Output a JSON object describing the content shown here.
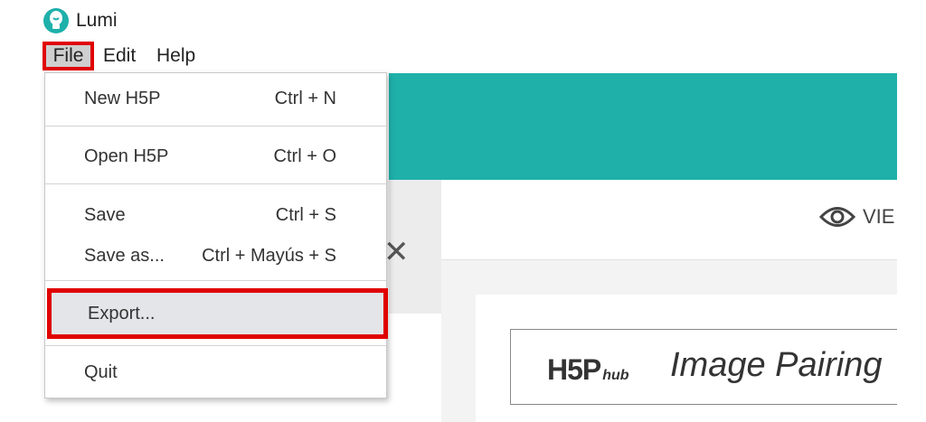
{
  "app": {
    "title": "Lumi"
  },
  "menubar": {
    "file": "File",
    "edit": "Edit",
    "help": "Help"
  },
  "file_menu": {
    "new": {
      "label": "New H5P",
      "shortcut": "Ctrl + N"
    },
    "open": {
      "label": "Open H5P",
      "shortcut": "Ctrl + O"
    },
    "save": {
      "label": "Save",
      "shortcut": "Ctrl + S"
    },
    "save_as": {
      "label": "Save as...",
      "shortcut": "Ctrl + Mayús + S"
    },
    "export": {
      "label": "Export..."
    },
    "quit": {
      "label": "Quit"
    }
  },
  "editor": {
    "view_label": "VIE",
    "hub_logo_main": "H5P",
    "hub_logo_sub": "hub",
    "content_title": "Image Pairing"
  },
  "colors": {
    "accent_teal": "#1fb0aa",
    "highlight_red": "#e00000"
  },
  "icons": [
    "lumi-logo-icon",
    "close-icon",
    "eye-icon"
  ]
}
